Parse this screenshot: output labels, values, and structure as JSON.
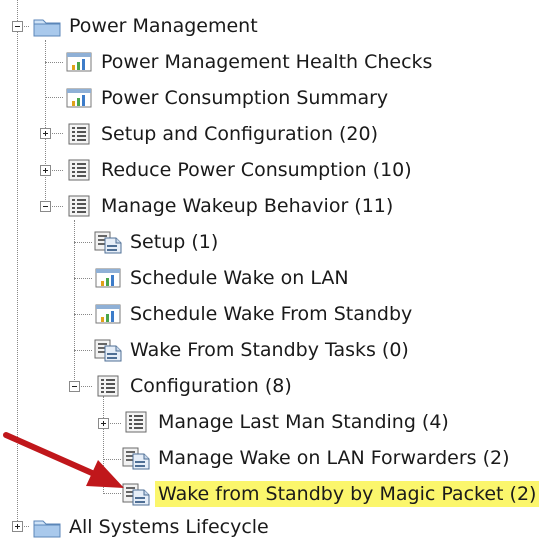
{
  "tree": {
    "nodes": [
      {
        "label": "Power Management",
        "icon": "folder-icon",
        "state": "expanded"
      },
      {
        "label": "Power Management Health Checks",
        "icon": "report-chart-icon"
      },
      {
        "label": "Power Consumption Summary",
        "icon": "report-chart-icon"
      },
      {
        "label": "Setup and Configuration (20)",
        "icon": "list-icon",
        "state": "collapsed"
      },
      {
        "label": "Reduce Power Consumption (10)",
        "icon": "list-icon",
        "state": "collapsed"
      },
      {
        "label": "Manage Wakeup Behavior (11)",
        "icon": "list-icon",
        "state": "expanded"
      },
      {
        "label": "Setup (1)",
        "icon": "task-document-icon"
      },
      {
        "label": "Schedule Wake on LAN",
        "icon": "report-chart-icon"
      },
      {
        "label": "Schedule Wake From Standby",
        "icon": "report-chart-icon"
      },
      {
        "label": "Wake From Standby Tasks (0)",
        "icon": "task-document-icon"
      },
      {
        "label": "Configuration (8)",
        "icon": "list-icon",
        "state": "expanded"
      },
      {
        "label": "Manage Last Man Standing (4)",
        "icon": "list-icon",
        "state": "collapsed"
      },
      {
        "label": "Manage Wake on LAN Forwarders (2)",
        "icon": "task-document-icon"
      },
      {
        "label": "Wake from Standby by Magic Packet (2)",
        "icon": "task-document-icon",
        "selected": true
      },
      {
        "label": "All Systems Lifecycle",
        "icon": "folder-icon",
        "state": "collapsed"
      }
    ]
  },
  "colors": {
    "selection_highlight": "#fbf66c",
    "arrow": "#c0171b"
  }
}
